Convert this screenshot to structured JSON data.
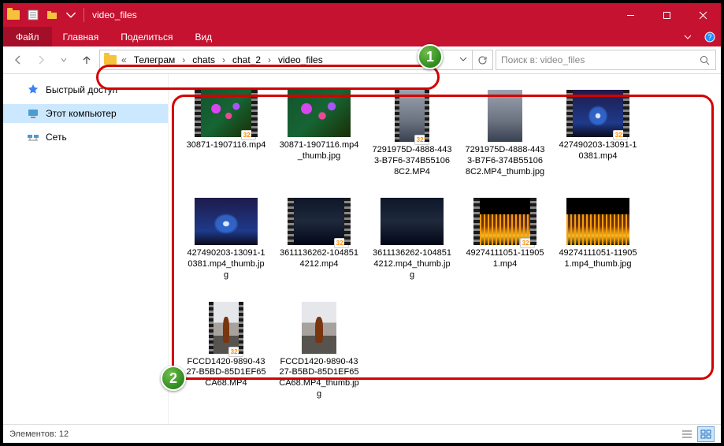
{
  "window": {
    "title": "video_files"
  },
  "menubar": {
    "file": "Файл",
    "tabs": [
      "Главная",
      "Поделиться",
      "Вид"
    ]
  },
  "breadcrumb": {
    "prefix": "«",
    "items": [
      "Телеграм",
      "chats",
      "chat_2",
      "video_files"
    ]
  },
  "search": {
    "placeholder": "Поиск в: video_files"
  },
  "nav": {
    "items": [
      {
        "label": "Быстрый доступ",
        "icon": "star"
      },
      {
        "label": "Этот компьютер",
        "icon": "pc",
        "selected": true
      },
      {
        "label": "Сеть",
        "icon": "net"
      }
    ]
  },
  "files": [
    {
      "name": "30871-1907116.mp4",
      "thumb": "flowers",
      "video": true,
      "portrait": false
    },
    {
      "name": "30871-1907116.mp4_thumb.jpg",
      "thumb": "flowers",
      "video": false,
      "portrait": false
    },
    {
      "name": "7291975D-4888-4433-B7F6-374B551068C2.MP4",
      "thumb": "fog",
      "video": true,
      "portrait": true
    },
    {
      "name": "7291975D-4888-4433-B7F6-374B551068C2.MP4_thumb.jpg",
      "thumb": "fog",
      "video": false,
      "portrait": true
    },
    {
      "name": "427490203-13091-10381.mp4",
      "thumb": "tree-night",
      "video": true,
      "portrait": false
    },
    {
      "name": "427490203-13091-10381.mp4_thumb.jpg",
      "thumb": "tree-night",
      "video": false,
      "portrait": false
    },
    {
      "name": "3611136262-1048514212.mp4",
      "thumb": "dark-forest",
      "video": true,
      "portrait": false
    },
    {
      "name": "3611136262-1048514212.mp4_thumb.jpg",
      "thumb": "dark-forest",
      "video": false,
      "portrait": false
    },
    {
      "name": "49274111051-119051.mp4",
      "thumb": "city-night",
      "video": true,
      "portrait": false
    },
    {
      "name": "49274111051-119051.mp4_thumb.jpg",
      "thumb": "city-night",
      "video": false,
      "portrait": false
    },
    {
      "name": "FCCD1420-9890-4327-B5BD-85D1EF65CA68.MP4",
      "thumb": "deer",
      "video": true,
      "portrait": true
    },
    {
      "name": "FCCD1420-9890-4327-B5BD-85D1EF65CA68.MP4_thumb.jpg",
      "thumb": "deer",
      "video": false,
      "portrait": true
    }
  ],
  "status": {
    "count_label": "Элементов:",
    "count": 12
  },
  "callouts": {
    "one": "1",
    "two": "2"
  }
}
